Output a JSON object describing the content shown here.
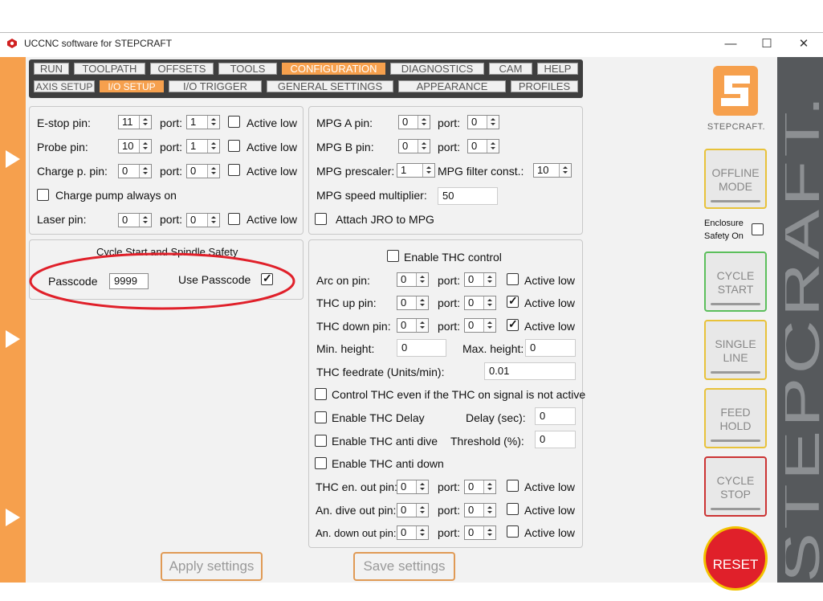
{
  "window": {
    "title": "UCCNC software for STEPCRAFT",
    "controls": [
      "—",
      "☐",
      "✕"
    ]
  },
  "tabs_top": [
    "RUN",
    "TOOLPATH",
    "OFFSETS",
    "TOOLS",
    "CONFIGURATION",
    "DIAGNOSTICS",
    "CAM",
    "HELP"
  ],
  "tabs_sub": [
    "AXIS SETUP",
    "I/O SETUP",
    "I/O TRIGGER",
    "GENERAL SETTINGS",
    "APPEARANCE",
    "PROFILES"
  ],
  "active_top": "CONFIGURATION",
  "active_sub": "I/O SETUP",
  "pins": {
    "estop_label": "E-stop pin:",
    "estop_pin": "11",
    "estop_port": "1",
    "probe_label": "Probe pin:",
    "probe_pin": "10",
    "probe_port": "1",
    "charge_label": "Charge p. pin:",
    "charge_pin": "0",
    "charge_port": "0",
    "charge_always_on": "Charge pump always on",
    "laser_label": "Laser pin:",
    "laser_pin": "0",
    "laser_port": "0",
    "port_label": "port:",
    "active_low": "Active low"
  },
  "mpg": {
    "a_label": "MPG A pin:",
    "a_pin": "0",
    "a_port": "0",
    "b_label": "MPG B pin:",
    "b_pin": "0",
    "b_port": "0",
    "prescaler_label": "MPG prescaler:",
    "prescaler": "1",
    "filter_label": "MPG filter const.:",
    "filter": "10",
    "speed_label": "MPG speed multiplier:",
    "speed": "50",
    "attach_label": "Attach JRO to MPG"
  },
  "safety": {
    "title": "Cycle Start and Spindle Safety",
    "passcode_label": "Passcode",
    "passcode": "9999",
    "use_passcode_label": "Use Passcode"
  },
  "thc": {
    "enable_label": "Enable THC control",
    "arc_label": "Arc on pin:",
    "arc_pin": "0",
    "arc_port": "0",
    "up_label": "THC up pin:",
    "up_pin": "0",
    "up_port": "0",
    "down_label": "THC down pin:",
    "down_pin": "0",
    "down_port": "0",
    "min_label": "Min. height:",
    "min": "0",
    "max_label": "Max. height:",
    "max": "0",
    "feed_label": "THC feedrate (Units/min):",
    "feed": "0.01",
    "control_even_label": "Control THC even if the THC on signal is not active",
    "delay_enable_label": "Enable THC Delay",
    "delay_label": "Delay (sec):",
    "delay": "0",
    "antidive_label": "Enable THC anti dive",
    "threshold_label": "Threshold (%):",
    "threshold": "0",
    "antidown_label": "Enable THC anti down",
    "en_out_label": "THC en. out pin:",
    "en_out_pin": "0",
    "en_out_port": "0",
    "dive_out_label": "An. dive out pin:",
    "dive_out_pin": "0",
    "dive_out_port": "0",
    "down_out_label": "An. down out pin:",
    "down_out_pin": "0",
    "down_out_port": "0"
  },
  "buttons": {
    "apply": "Apply settings",
    "save": "Save settings"
  },
  "side": {
    "brand": "STEPCRAFT.",
    "offline": "OFFLINE MODE",
    "enclosure": "Enclosure Safety On",
    "cycle_start": "CYCLE START",
    "single_line": "SINGLE LINE",
    "feed_hold": "FEED HOLD",
    "cycle_stop": "CYCLE STOP",
    "reset": "RESET",
    "vertical_brand": "STEPCRAFT."
  },
  "colors": {
    "accent": "#f6a04d",
    "annotation": "#e0202a",
    "cycle_start": "#5cbf5c",
    "feed_hold": "#e8c23a",
    "cycle_stop": "#c33",
    "reset": "#e0202a"
  }
}
